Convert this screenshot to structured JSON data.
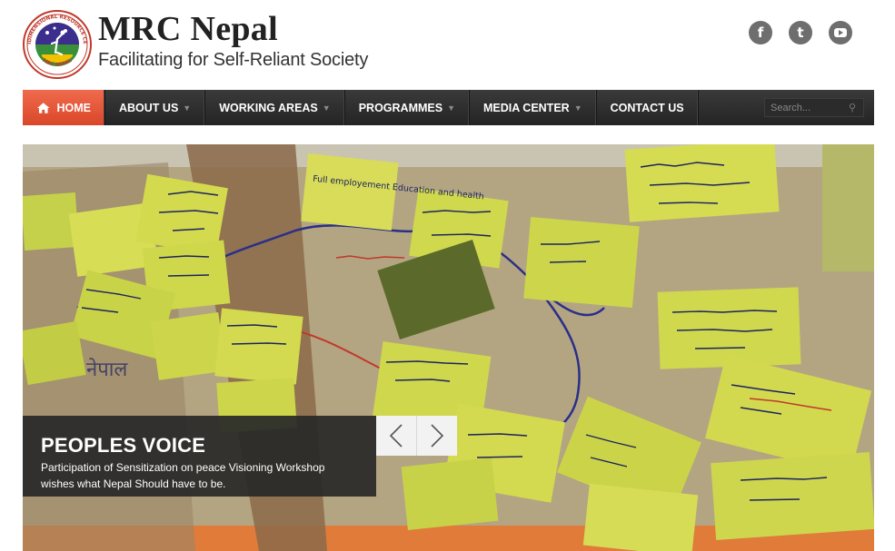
{
  "header": {
    "title": "MRC Nepal",
    "tagline": "Facilitating for Self-Reliant Society",
    "logo": {
      "ring_text_top": "MULTIDIMENSIONAL RESOURCE CENTER",
      "ring_text_bottom": "MRC NEPAL"
    }
  },
  "social": [
    {
      "name": "facebook-icon",
      "glyph": "f"
    },
    {
      "name": "twitter-icon",
      "glyph": "t"
    },
    {
      "name": "youtube-icon",
      "glyph": ""
    }
  ],
  "nav": {
    "home": "HOME",
    "about": "ABOUT US",
    "working": "WORKING AREAS",
    "programmes": "PROGRAMMES",
    "media": "MEDIA CENTER",
    "contact": "CONTACT US",
    "search_placeholder": "Search..."
  },
  "slider": {
    "title": "PEOPLES VOICE",
    "text": "Participation of Sensitization on peace Visioning Workshop wishes what Nepal Should have to be.",
    "note_texts": [
      "Full employement Education and health",
      "नेपाल"
    ]
  },
  "colors": {
    "accent": "#e4533a",
    "nav_bg": "#2b2b2b",
    "caption_bg": "#2a2a2a"
  }
}
